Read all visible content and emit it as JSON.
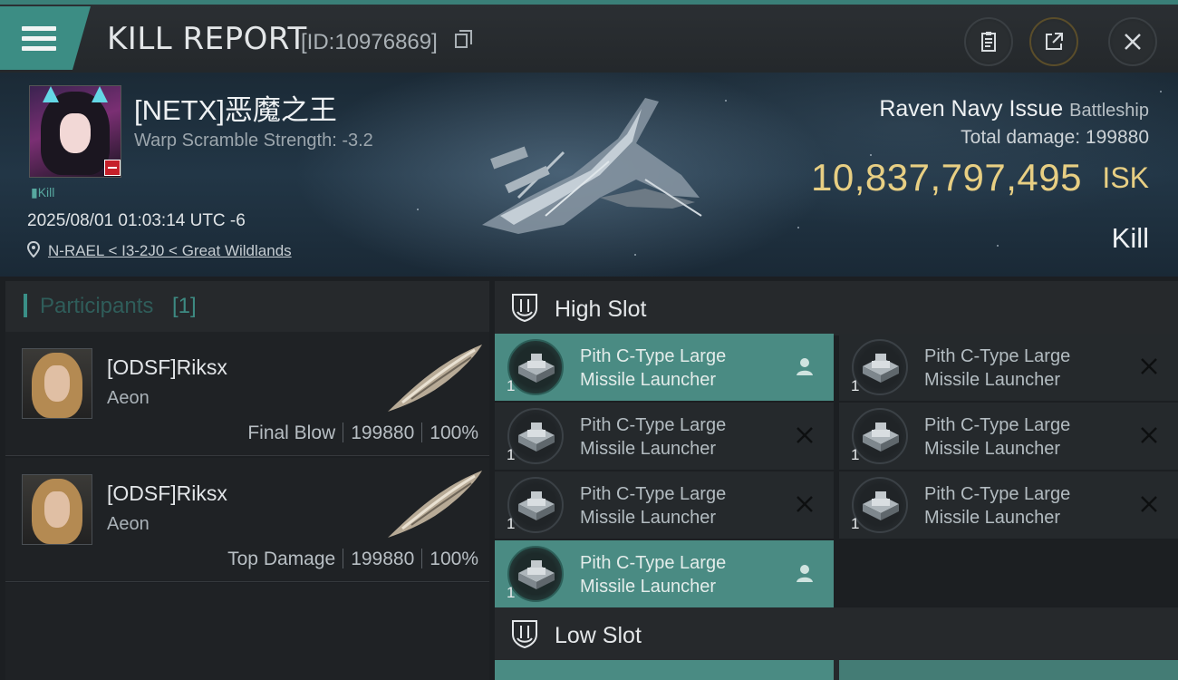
{
  "header": {
    "title": "KILL REPORT",
    "report_id": "[ID:10976869]"
  },
  "victim": {
    "name": "[NETX]恶魔之王",
    "warp_scramble": "Warp Scramble Strength: -3.2",
    "tag": "Kill",
    "datetime": "2025/08/01 01:03:14 UTC -6",
    "location": "N-RAEL < I3-2J0 < Great Wildlands",
    "ship_name": "Raven Navy Issue",
    "ship_class": "Battleship",
    "total_damage": "Total damage: 199880",
    "isk_value": "10,837,797,495",
    "isk_unit": "ISK",
    "result": "Kill"
  },
  "participants": {
    "label": "Participants",
    "count": "[1]",
    "rows": [
      {
        "name": "[ODSF]Riksx",
        "ship": "Aeon",
        "role": "Final Blow",
        "damage": "199880",
        "percent": "100%"
      },
      {
        "name": "[ODSF]Riksx",
        "ship": "Aeon",
        "role": "Top Damage",
        "damage": "199880",
        "percent": "100%"
      }
    ]
  },
  "slots": {
    "high_label": "High Slot",
    "low_label": "Low Slot",
    "modules": [
      {
        "name_line1": "Pith C-Type Large",
        "name_line2": "Missile Launcher",
        "qty": "1",
        "state": "fitted"
      },
      {
        "name_line1": "Pith C-Type Large",
        "name_line2": "Missile Launcher",
        "qty": "1",
        "state": "destroyed"
      },
      {
        "name_line1": "Pith C-Type Large",
        "name_line2": "Missile Launcher",
        "qty": "1",
        "state": "destroyed"
      },
      {
        "name_line1": "Pith C-Type Large",
        "name_line2": "Missile Launcher",
        "qty": "1",
        "state": "destroyed"
      },
      {
        "name_line1": "Pith C-Type Large",
        "name_line2": "Missile Launcher",
        "qty": "1",
        "state": "destroyed"
      },
      {
        "name_line1": "Pith C-Type Large",
        "name_line2": "Missile Launcher",
        "qty": "1",
        "state": "destroyed"
      },
      {
        "name_line1": "Pith C-Type Large",
        "name_line2": "Missile Launcher",
        "qty": "1",
        "state": "fitted"
      }
    ]
  },
  "colors": {
    "accent": "#3c8d84",
    "active_module": "#4a8b83",
    "isk_gold": "#e8cf83",
    "background": "#1c1f22"
  },
  "icons": {
    "menu": "hamburger-icon",
    "copy": "copy-icon",
    "clipboard": "clipboard-icon",
    "share": "share-icon",
    "close": "close-icon",
    "location": "location-pin-icon",
    "slot": "shield-icon",
    "pilot": "pilot-icon",
    "destroyed": "x-icon"
  }
}
